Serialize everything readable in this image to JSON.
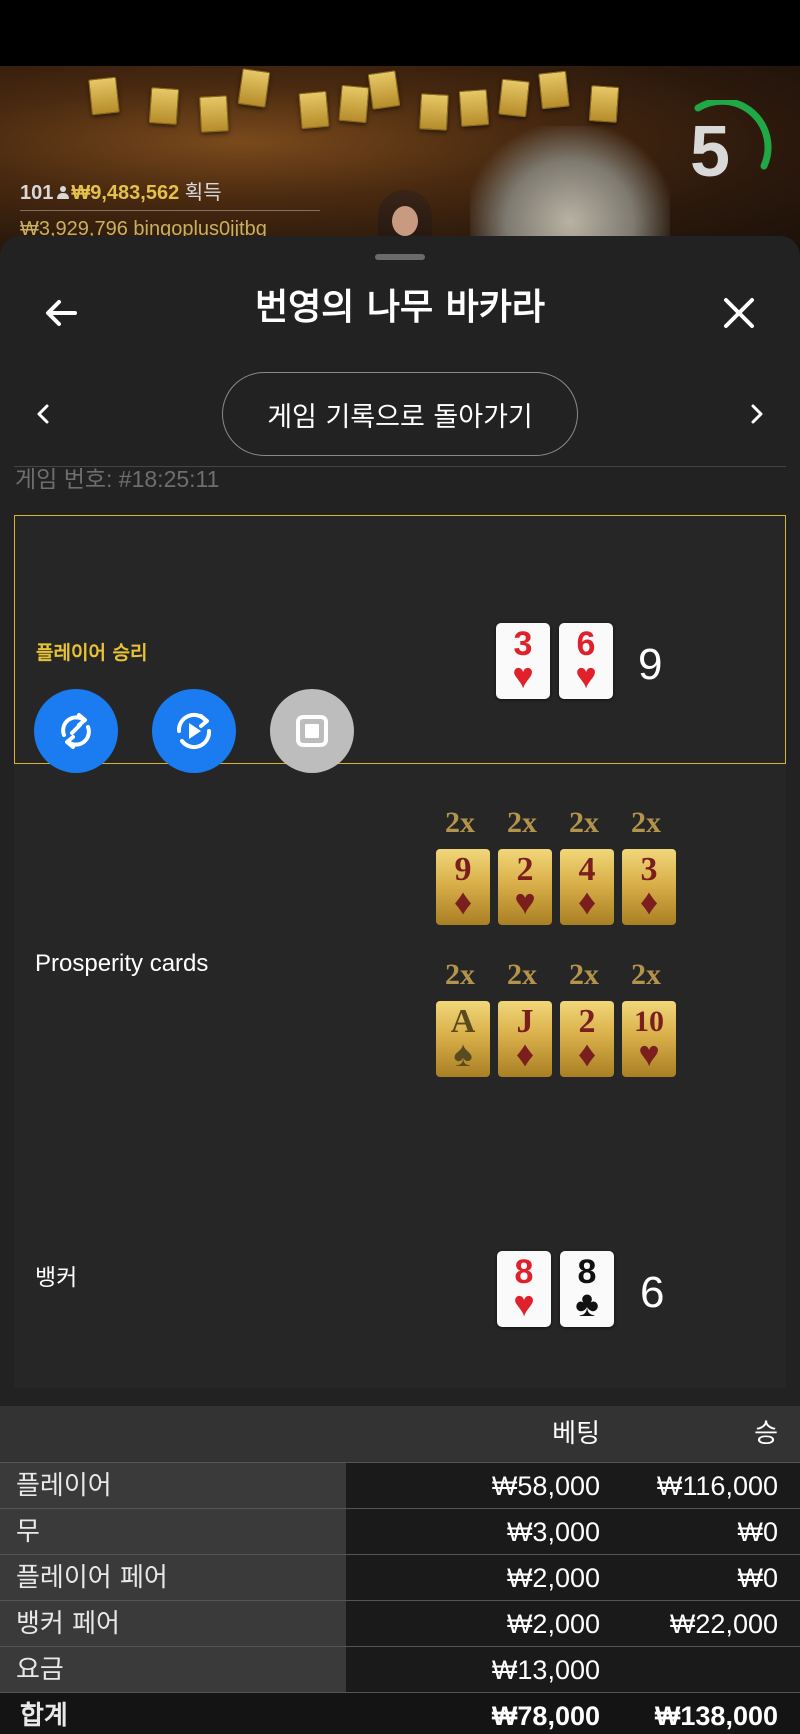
{
  "stream": {
    "timer": "5",
    "winners_count": "101",
    "winners_amount": "₩9,483,562",
    "winners_suffix": "획득",
    "recent_win": "₩3,929,796  bingoplus0jjtbg"
  },
  "header": {
    "title": "번영의 나무 바카라",
    "back_icon": "arrow-left-icon",
    "close_icon": "close-icon"
  },
  "nav": {
    "back_to_history": "게임 기록으로 돌아가기",
    "prev_icon": "chevron-left-icon",
    "next_icon": "chevron-right-icon"
  },
  "game": {
    "number": "게임 번호: #18:25:11",
    "player": {
      "result_label": "플레이어 승리",
      "cards": [
        {
          "rank": "3",
          "suit": "♥"
        },
        {
          "rank": "6",
          "suit": "♥"
        }
      ],
      "total": "9"
    },
    "prosperity": {
      "label": "Prosperity cards",
      "cards": [
        {
          "mult": "2x",
          "rank": "9",
          "suit": "♦"
        },
        {
          "mult": "2x",
          "rank": "2",
          "suit": "♥"
        },
        {
          "mult": "2x",
          "rank": "4",
          "suit": "♦"
        },
        {
          "mult": "2x",
          "rank": "3",
          "suit": "♦"
        },
        {
          "mult": "2x",
          "rank": "A",
          "suit": "♠"
        },
        {
          "mult": "2x",
          "rank": "J",
          "suit": "♦"
        },
        {
          "mult": "2x",
          "rank": "2",
          "suit": "♦"
        },
        {
          "mult": "2x",
          "rank": "10",
          "suit": "♥"
        }
      ]
    },
    "banker": {
      "label": "뱅커",
      "cards": [
        {
          "rank": "8",
          "suit": "♥"
        },
        {
          "rank": "8",
          "suit": "♣"
        }
      ],
      "total": "6"
    }
  },
  "controls": {
    "rotate_icon": "rotate-icon",
    "replay_icon": "replay-icon",
    "stop_icon": "stop-icon"
  },
  "bets": {
    "col_bet": "베팅",
    "col_win": "승",
    "rows": [
      {
        "label": "플레이어",
        "bet": "₩58,000",
        "win": "₩116,000"
      },
      {
        "label": "무",
        "bet": "₩3,000",
        "win": "₩0"
      },
      {
        "label": "플레이어 페어",
        "bet": "₩2,000",
        "win": "₩0"
      },
      {
        "label": "뱅커 페어",
        "bet": "₩2,000",
        "win": "₩22,000"
      },
      {
        "label": "요금",
        "bet": "₩13,000",
        "win": ""
      }
    ],
    "total": {
      "label": "합계",
      "bet": "₩78,000",
      "win": "₩138,000"
    }
  },
  "colors": {
    "accent_gold": "#e8c336",
    "fab_blue": "#1a7cf0",
    "sheet_bg": "#222222"
  }
}
